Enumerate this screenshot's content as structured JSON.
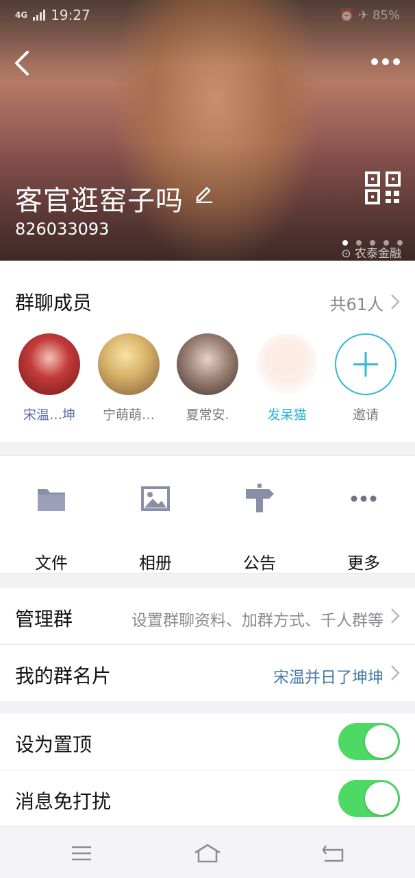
{
  "status_bar": {
    "network": "4G",
    "time": "19:27",
    "right": "⏰ ✈ 85%"
  },
  "header": {
    "group_name": "客官逛窑子吗",
    "group_id": "826033093",
    "watermark": "⊙ 农泰金融",
    "carousel_dots": 5,
    "active_dot": 1
  },
  "members": {
    "title": "群聊成员",
    "count": "共61人",
    "list": [
      {
        "name": "宋温…坤",
        "color": "#5a6aa8"
      },
      {
        "name": "宁萌萌…",
        "color": "#7a7a85"
      },
      {
        "name": "夏常安.",
        "color": "#7a7a85"
      },
      {
        "name": "发呆猫",
        "color": "#27b3d6"
      }
    ],
    "invite_label": "邀请"
  },
  "actions": [
    {
      "label": "文件",
      "icon": "folder-icon"
    },
    {
      "label": "相册",
      "icon": "photo-icon"
    },
    {
      "label": "公告",
      "icon": "signpost-icon"
    },
    {
      "label": "更多",
      "icon": "more-horizontal-icon"
    }
  ],
  "rows": {
    "manage": {
      "label": "管理群",
      "value": "设置群聊资料、加群方式、千人群等"
    },
    "card": {
      "label": "我的群名片",
      "value": "宋温并日了坤坤"
    },
    "pin": {
      "label": "设为置顶",
      "on": true
    },
    "mute": {
      "label": "消息免打扰",
      "on": true
    }
  },
  "colors": {
    "toggle_on": "#4cd964",
    "accent": "#2fb8d9",
    "link": "#4a78a8"
  }
}
